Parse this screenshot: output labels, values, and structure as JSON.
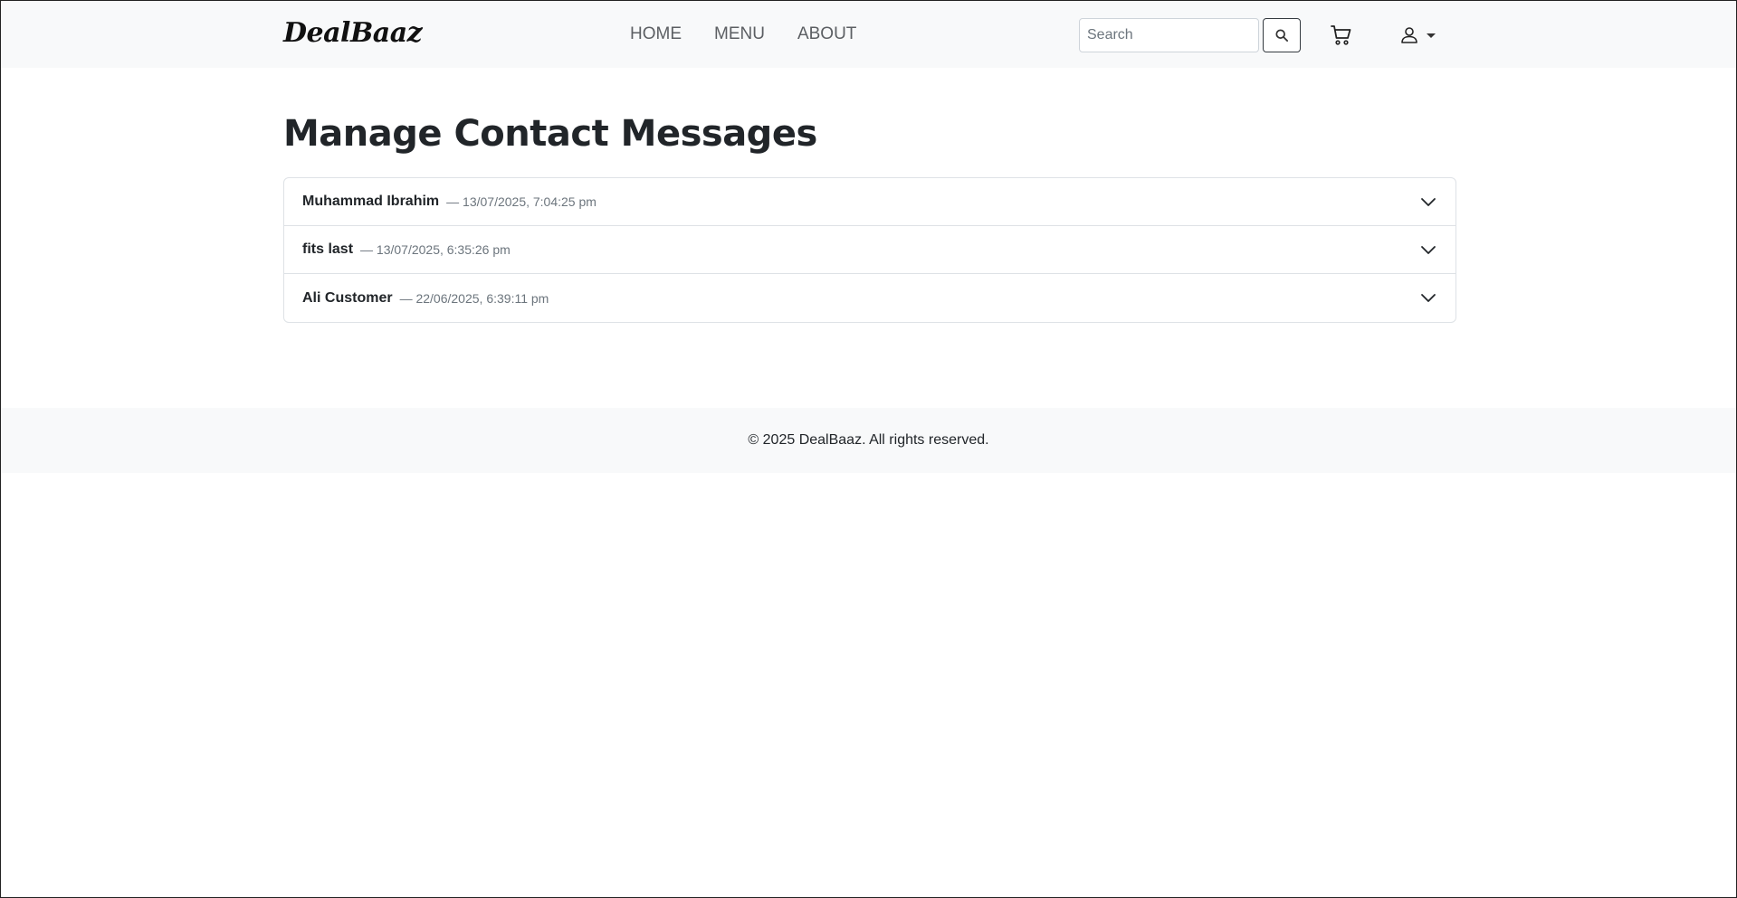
{
  "navbar": {
    "brand": "DealBaaz",
    "links": [
      "HOME",
      "MENU",
      "ABOUT"
    ],
    "search": {
      "placeholder": "Search",
      "value": ""
    },
    "icons": {
      "search": "search-icon",
      "cart": "cart-icon",
      "user": "user-icon",
      "caret": "caret-down-icon"
    }
  },
  "main": {
    "title": "Manage Contact Messages",
    "messages": [
      {
        "name": "Muhammad Ibrahim",
        "date": "— 13/07/2025, 7:04:25 pm"
      },
      {
        "name": "fits last",
        "date": "— 13/07/2025, 6:35:26 pm"
      },
      {
        "name": "Ali Customer",
        "date": "— 22/06/2025, 6:39:11 pm"
      }
    ]
  },
  "footer": {
    "text": "© 2025 DealBaaz. All rights reserved."
  }
}
